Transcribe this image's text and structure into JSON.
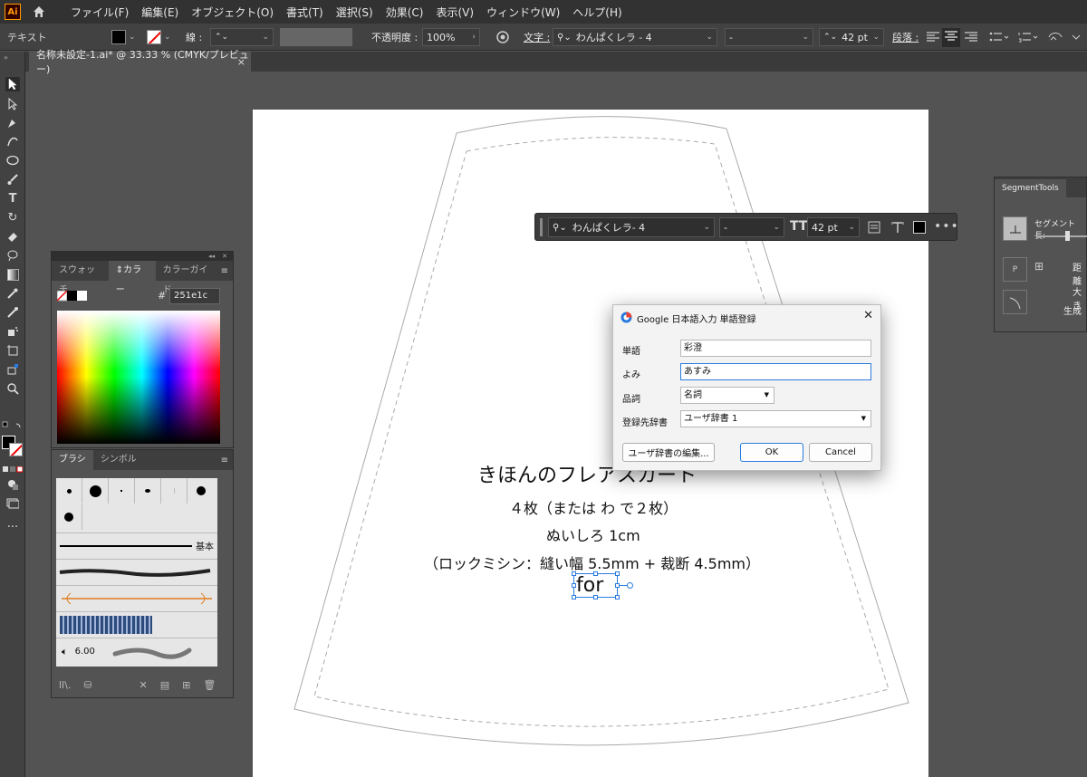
{
  "menubar": {
    "logo": "Ai",
    "items": [
      "ファイル(F)",
      "編集(E)",
      "オブジェクト(O)",
      "書式(T)",
      "選択(S)",
      "効果(C)",
      "表示(V)",
      "ウィンドウ(W)",
      "ヘルプ(H)"
    ]
  },
  "controlbar": {
    "mode": "テキスト",
    "stroke_label": "線 :",
    "opacity_label": "不透明度 :",
    "opacity_value": "100%",
    "char_label": "文字 :",
    "font_name": "わんぱくレラ - 4",
    "font_style": "-",
    "font_size": "42 pt",
    "para_label": "段落 :"
  },
  "tab": {
    "title": "名称未設定-1.ai* @ 33.33 % (CMYK/プレビュー)",
    "close": "×"
  },
  "textbar": {
    "font_name": "わんぱくレラ- 4",
    "font_style": "-",
    "font_size": "42 pt"
  },
  "color_panel": {
    "tabs": [
      "スウォッチ",
      "カラー",
      "カラーガイド"
    ],
    "hex_label": "#",
    "hex_value": "251e1c"
  },
  "brush_panel": {
    "tabs": [
      "ブラシ",
      "シンボル"
    ],
    "basic_label": "基本",
    "stroke_value": "6.00"
  },
  "segment_panel": {
    "title": "SegmentTools",
    "segment_length_label": "セグメント長:",
    "distance_label": "距離",
    "size_label": "大き",
    "generate_label": "生成"
  },
  "artwork": {
    "title": "きほんのフレアスカート",
    "line1": "４枚（または わ で２枚）",
    "line2": "ぬいしろ 1cm",
    "line3": "（ロックミシン：縫い幅 5.5mm + 裁断 4.5mm）",
    "selected_text": "for"
  },
  "dialog": {
    "title": "Google 日本語入力 単語登録",
    "close": "✕",
    "word_label": "単語",
    "word_value": "彩澄",
    "reading_label": "よみ",
    "reading_value": "あすみ",
    "pos_label": "品詞",
    "pos_value": "名詞",
    "dict_label": "登録先辞書",
    "dict_value": "ユーザ辞書 1",
    "edit_button": "ユーザ辞書の編集...",
    "ok_button": "OK",
    "cancel_button": "Cancel"
  },
  "colors": {
    "accent_blue": "#2a7bde",
    "fill_color": "#251e1c"
  }
}
